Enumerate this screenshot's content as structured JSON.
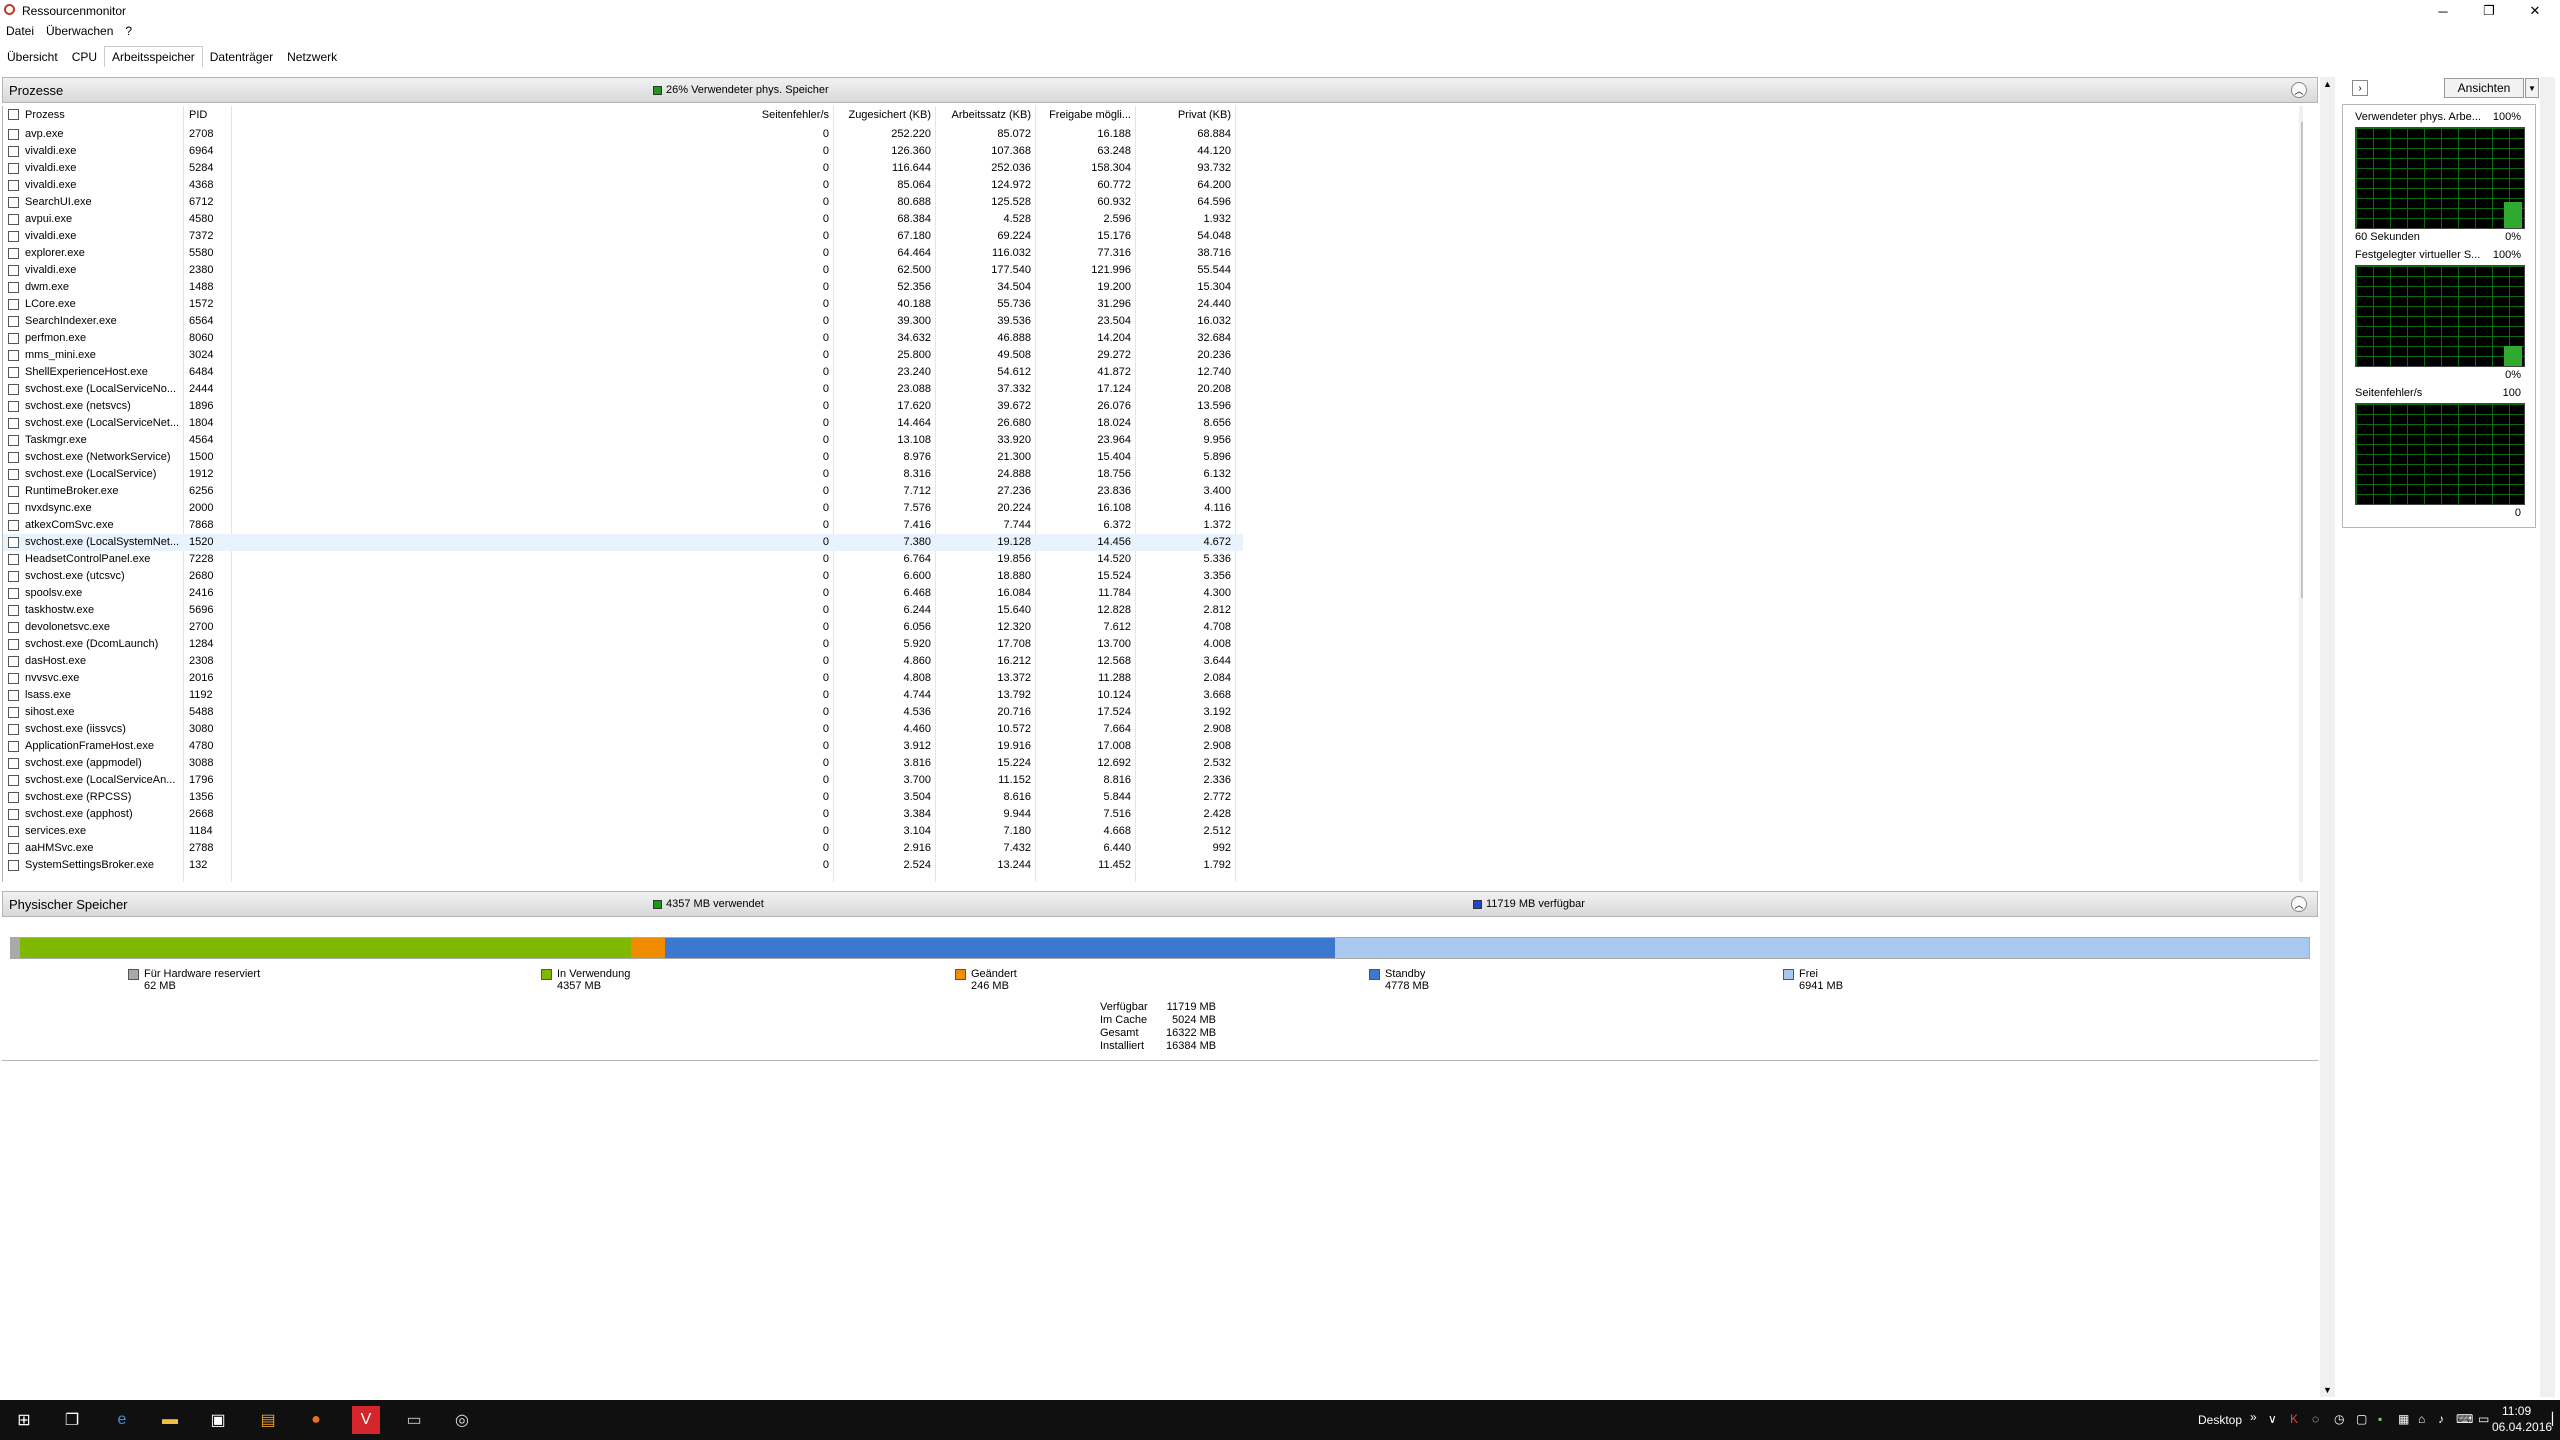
{
  "window": {
    "title": "Ressourcenmonitor",
    "minimize": "─",
    "maximize": "❐",
    "close": "✕"
  },
  "menu": [
    "Datei",
    "Überwachen",
    "?"
  ],
  "tabs": [
    "Übersicht",
    "CPU",
    "Arbeitsspeicher",
    "Datenträger",
    "Netzwerk"
  ],
  "active_tab": "Arbeitsspeicher",
  "processes": {
    "title": "Prozesse",
    "info": "26% Verwendeter phys. Speicher",
    "info_color": "#1a9a1a",
    "columns": [
      "Prozess",
      "PID",
      "Seitenfehler/s",
      "Zugesichert (KB)",
      "Arbeitssatz (KB)",
      "Freigabe mögli...",
      "Privat (KB)"
    ],
    "rows": [
      [
        "avp.exe",
        "2708",
        "0",
        "252.220",
        "85.072",
        "16.188",
        "68.884"
      ],
      [
        "vivaldi.exe",
        "6964",
        "0",
        "126.360",
        "107.368",
        "63.248",
        "44.120"
      ],
      [
        "vivaldi.exe",
        "5284",
        "0",
        "116.644",
        "252.036",
        "158.304",
        "93.732"
      ],
      [
        "vivaldi.exe",
        "4368",
        "0",
        "85.064",
        "124.972",
        "60.772",
        "64.200"
      ],
      [
        "SearchUI.exe",
        "6712",
        "0",
        "80.688",
        "125.528",
        "60.932",
        "64.596"
      ],
      [
        "avpui.exe",
        "4580",
        "0",
        "68.384",
        "4.528",
        "2.596",
        "1.932"
      ],
      [
        "vivaldi.exe",
        "7372",
        "0",
        "67.180",
        "69.224",
        "15.176",
        "54.048"
      ],
      [
        "explorer.exe",
        "5580",
        "0",
        "64.464",
        "116.032",
        "77.316",
        "38.716"
      ],
      [
        "vivaldi.exe",
        "2380",
        "0",
        "62.500",
        "177.540",
        "121.996",
        "55.544"
      ],
      [
        "dwm.exe",
        "1488",
        "0",
        "52.356",
        "34.504",
        "19.200",
        "15.304"
      ],
      [
        "LCore.exe",
        "1572",
        "0",
        "40.188",
        "55.736",
        "31.296",
        "24.440"
      ],
      [
        "SearchIndexer.exe",
        "6564",
        "0",
        "39.300",
        "39.536",
        "23.504",
        "16.032"
      ],
      [
        "perfmon.exe",
        "8060",
        "0",
        "34.632",
        "46.888",
        "14.204",
        "32.684"
      ],
      [
        "mms_mini.exe",
        "3024",
        "0",
        "25.800",
        "49.508",
        "29.272",
        "20.236"
      ],
      [
        "ShellExperienceHost.exe",
        "6484",
        "0",
        "23.240",
        "54.612",
        "41.872",
        "12.740"
      ],
      [
        "svchost.exe (LocalServiceNo...",
        "2444",
        "0",
        "23.088",
        "37.332",
        "17.124",
        "20.208"
      ],
      [
        "svchost.exe (netsvcs)",
        "1896",
        "0",
        "17.620",
        "39.672",
        "26.076",
        "13.596"
      ],
      [
        "svchost.exe (LocalServiceNet...",
        "1804",
        "0",
        "14.464",
        "26.680",
        "18.024",
        "8.656"
      ],
      [
        "Taskmgr.exe",
        "4564",
        "0",
        "13.108",
        "33.920",
        "23.964",
        "9.956"
      ],
      [
        "svchost.exe (NetworkService)",
        "1500",
        "0",
        "8.976",
        "21.300",
        "15.404",
        "5.896"
      ],
      [
        "svchost.exe (LocalService)",
        "1912",
        "0",
        "8.316",
        "24.888",
        "18.756",
        "6.132"
      ],
      [
        "RuntimeBroker.exe",
        "6256",
        "0",
        "7.712",
        "27.236",
        "23.836",
        "3.400"
      ],
      [
        "nvxdsync.exe",
        "2000",
        "0",
        "7.576",
        "20.224",
        "16.108",
        "4.116"
      ],
      [
        "atkexComSvc.exe",
        "7868",
        "0",
        "7.416",
        "7.744",
        "6.372",
        "1.372"
      ],
      [
        "svchost.exe (LocalSystemNet...",
        "1520",
        "0",
        "7.380",
        "19.128",
        "14.456",
        "4.672"
      ],
      [
        "HeadsetControlPanel.exe",
        "7228",
        "0",
        "6.764",
        "19.856",
        "14.520",
        "5.336"
      ],
      [
        "svchost.exe (utcsvc)",
        "2680",
        "0",
        "6.600",
        "18.880",
        "15.524",
        "3.356"
      ],
      [
        "spoolsv.exe",
        "2416",
        "0",
        "6.468",
        "16.084",
        "11.784",
        "4.300"
      ],
      [
        "taskhostw.exe",
        "5696",
        "0",
        "6.244",
        "15.640",
        "12.828",
        "2.812"
      ],
      [
        "devolonetsvc.exe",
        "2700",
        "0",
        "6.056",
        "12.320",
        "7.612",
        "4.708"
      ],
      [
        "svchost.exe (DcomLaunch)",
        "1284",
        "0",
        "5.920",
        "17.708",
        "13.700",
        "4.008"
      ],
      [
        "dasHost.exe",
        "2308",
        "0",
        "4.860",
        "16.212",
        "12.568",
        "3.644"
      ],
      [
        "nvvsvc.exe",
        "2016",
        "0",
        "4.808",
        "13.372",
        "11.288",
        "2.084"
      ],
      [
        "lsass.exe",
        "1192",
        "0",
        "4.744",
        "13.792",
        "10.124",
        "3.668"
      ],
      [
        "sihost.exe",
        "5488",
        "0",
        "4.536",
        "20.716",
        "17.524",
        "3.192"
      ],
      [
        "svchost.exe (iissvcs)",
        "3080",
        "0",
        "4.460",
        "10.572",
        "7.664",
        "2.908"
      ],
      [
        "ApplicationFrameHost.exe",
        "4780",
        "0",
        "3.912",
        "19.916",
        "17.008",
        "2.908"
      ],
      [
        "svchost.exe (appmodel)",
        "3088",
        "0",
        "3.816",
        "15.224",
        "12.692",
        "2.532"
      ],
      [
        "svchost.exe (LocalServiceAn...",
        "1796",
        "0",
        "3.700",
        "11.152",
        "8.816",
        "2.336"
      ],
      [
        "svchost.exe (RPCSS)",
        "1356",
        "0",
        "3.504",
        "8.616",
        "5.844",
        "2.772"
      ],
      [
        "svchost.exe (apphost)",
        "2668",
        "0",
        "3.384",
        "9.944",
        "7.516",
        "2.428"
      ],
      [
        "services.exe",
        "1184",
        "0",
        "3.104",
        "7.180",
        "4.668",
        "2.512"
      ],
      [
        "aaHMSvc.exe",
        "2788",
        "0",
        "2.916",
        "7.432",
        "6.440",
        "992"
      ],
      [
        "SystemSettingsBroker.exe",
        "132",
        "0",
        "2.524",
        "13.244",
        "11.452",
        "1.792"
      ]
    ],
    "selected_row": 24
  },
  "physical": {
    "title": "Physischer Speicher",
    "used_label": "4357 MB verwendet",
    "used_color": "#1a9a1a",
    "avail_label": "11719 MB verfügbar",
    "avail_color": "#2244cc",
    "segments": [
      {
        "label": "Für Hardware reserviert",
        "value": "62 MB",
        "mb": 62,
        "color": "#a9a9a9"
      },
      {
        "label": "In Verwendung",
        "value": "4357 MB",
        "mb": 4357,
        "color": "#7fb800"
      },
      {
        "label": "Geändert",
        "value": "246 MB",
        "mb": 246,
        "color": "#f08c00"
      },
      {
        "label": "Standby",
        "value": "4778 MB",
        "mb": 4778,
        "color": "#3c78d0"
      },
      {
        "label": "Frei",
        "value": "6941 MB",
        "mb": 6941,
        "color": "#a8c8f0"
      }
    ],
    "summary": [
      {
        "label": "Verfügbar",
        "value": "11719 MB"
      },
      {
        "label": "Im Cache",
        "value": "5024 MB"
      },
      {
        "label": "Gesamt",
        "value": "16322 MB"
      },
      {
        "label": "Installiert",
        "value": "16384 MB"
      }
    ]
  },
  "side": {
    "views_button": "Ansichten",
    "graphs": [
      {
        "label": "Verwendeter phys. Arbe...",
        "top": "100%",
        "bottom_left": "60 Sekunden",
        "bottom_right": "0%",
        "level": 0.26
      },
      {
        "label": "Festgelegter virtueller S...",
        "top": "100%",
        "bottom_left": "",
        "bottom_right": "0%",
        "level": 0.2
      },
      {
        "label": "Seitenfehler/s",
        "top": "100",
        "bottom_left": "",
        "bottom_right": "0",
        "level": 0
      }
    ]
  },
  "taskbar": {
    "desktop": "Desktop",
    "time": "11:09",
    "date": "06.04.2016"
  }
}
